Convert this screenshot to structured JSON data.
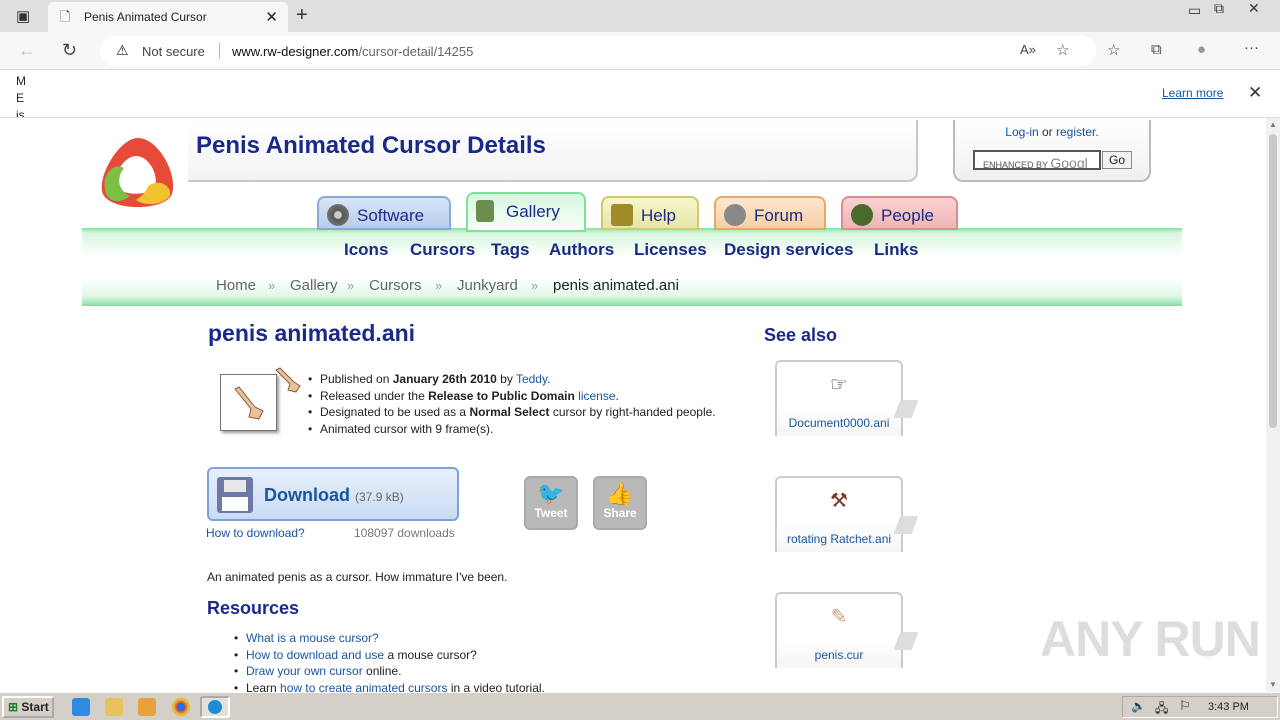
{
  "browser": {
    "tab_title": "Penis Animated Cursor",
    "not_secure": "Not secure",
    "url_host": "www.rw-designer.com",
    "url_path": "/cursor-detail/14255",
    "info_text": "M E is",
    "learn_more": "Learn more"
  },
  "site": {
    "title": "Penis Animated Cursor Details",
    "login": "Log-in",
    "or": "or",
    "register": "register.",
    "search_placeholder": "ENHANCED BY",
    "search_brand": "Googl",
    "go": "Go",
    "tabs": [
      "Software",
      "Gallery",
      "Help",
      "Forum",
      "People"
    ],
    "subnav": [
      "Icons",
      "Cursors",
      "Tags",
      "Authors",
      "Licenses",
      "Design services",
      "Links"
    ],
    "breadcrumb": [
      "Home",
      "Gallery",
      "Cursors",
      "Junkyard",
      "penis animated.ani"
    ]
  },
  "cursor": {
    "name": "penis animated.ani",
    "published_pre": "Published on",
    "published_date": "January 26th 2010",
    "by": "by",
    "author": "Teddy",
    "released_pre": "Released under the",
    "license_name": "Release to Public Domain",
    "license_link": "license",
    "designated_pre": "Designated to be used as a",
    "designated_type": "Normal Select",
    "designated_post": "cursor by right-handed people.",
    "frames": "Animated cursor with 9 frame(s).",
    "download": "Download",
    "size": "(37.9 kB)",
    "how_to_download": "How to download?",
    "downloads": "108097 downloads",
    "tweet": "Tweet",
    "share": "Share",
    "description": "An animated penis as a cursor. How immature I've been."
  },
  "resources": {
    "heading": "Resources",
    "items": [
      {
        "link": "What is a mouse cursor?",
        "text": ""
      },
      {
        "link": "How to download and use",
        "text": "a mouse cursor?"
      },
      {
        "link": "Draw your own cursor",
        "text": "online."
      },
      {
        "pre": "Learn",
        "link": "how to create animated cursors",
        "text": "in a video tutorial."
      }
    ]
  },
  "see_also": {
    "heading": "See also",
    "items": [
      "Document0000.ani",
      "rotating Ratchet.ani",
      "penis.cur"
    ]
  },
  "watermark": "ANY RUN",
  "taskbar": {
    "start": "Start",
    "time": "3:43 PM"
  }
}
